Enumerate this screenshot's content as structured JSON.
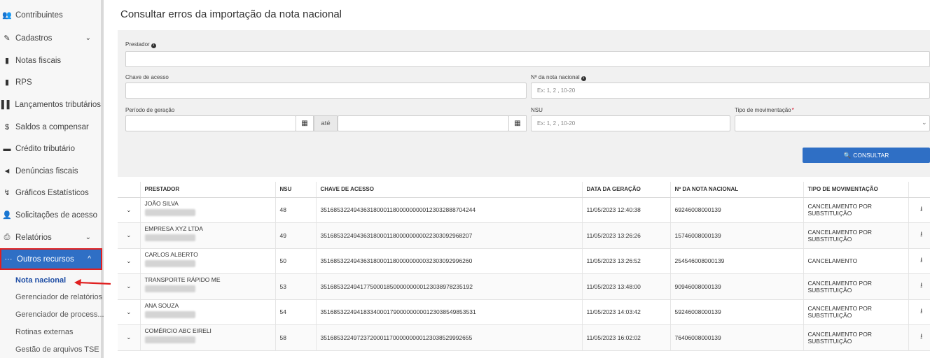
{
  "sidebar": {
    "items": [
      {
        "icon": "users-icon",
        "glyph": "👥",
        "label": "Contribuintes",
        "chevron": ""
      },
      {
        "icon": "edit-icon",
        "glyph": "✎",
        "label": "Cadastros",
        "chevron": "⌄"
      },
      {
        "icon": "file-icon",
        "glyph": "▮",
        "label": "Notas fiscais",
        "chevron": ""
      },
      {
        "icon": "file-icon",
        "glyph": "▮",
        "label": "RPS",
        "chevron": ""
      },
      {
        "icon": "barcode-icon",
        "glyph": "▌▌",
        "label": "Lançamentos tributários",
        "chevron": ""
      },
      {
        "icon": "dollar-icon",
        "glyph": "$",
        "label": "Saldos a compensar",
        "chevron": ""
      },
      {
        "icon": "card-icon",
        "glyph": "▬",
        "label": "Crédito tributário",
        "chevron": ""
      },
      {
        "icon": "megaphone-icon",
        "glyph": "◄",
        "label": "Denúncias fiscais",
        "chevron": ""
      },
      {
        "icon": "chart-icon",
        "glyph": "↯",
        "label": "Gráficos Estatísticos",
        "chevron": ""
      },
      {
        "icon": "user-plus-icon",
        "glyph": "👤",
        "label": "Solicitações de acesso",
        "chevron": ""
      },
      {
        "icon": "print-icon",
        "glyph": "⎙",
        "label": "Relatórios",
        "chevron": "⌄"
      },
      {
        "icon": "dots-icon",
        "glyph": "···",
        "label": "Outros recursos",
        "chevron": "^"
      }
    ],
    "subitems": [
      "Nota nacional",
      "Gerenciador de relatórios",
      "Gerenciador de process...",
      "Rotinas externas",
      "Gestão de arquivos TSE"
    ]
  },
  "page": {
    "title": "Consultar erros da importação da nota nacional"
  },
  "filters": {
    "prestador_label": "Prestador",
    "chave_label": "Chave de acesso",
    "nota_label": "Nº da nota nacional",
    "nota_placeholder": "Ex: 1, 2 , 10-20",
    "periodo_label": "Período de geração",
    "ate": "até",
    "nsu_label": "NSU",
    "nsu_placeholder": "Ex: 1, 2 , 10-20",
    "tipo_label": "Tipo de movimentação",
    "required_mark": "*",
    "consultar_label": "CONSULTAR"
  },
  "table": {
    "headers": [
      "PRESTADOR",
      "NSU",
      "CHAVE DE ACESSO",
      "DATA DA GERAÇÃO",
      "Nº DA NOTA NACIONAL",
      "TIPO DE MOVIMENTAÇÃO"
    ],
    "rows": [
      {
        "prestador": "JOÃO SILVA",
        "nsu": "48",
        "chave": "35168532249436318000118000000000123032888704244",
        "data": "11/05/2023 12:40:38",
        "nota": "69246008000139",
        "tipo": "CANCELAMENTO POR SUBSTITUIÇÃO"
      },
      {
        "prestador": "EMPRESA XYZ LTDA",
        "nsu": "49",
        "chave": "35168532249436318000118000000000223030929682​07",
        "data": "11/05/2023 13:26:26",
        "nota": "15746008000139",
        "tipo": "CANCELAMENTO POR SUBSTITUIÇÃO"
      },
      {
        "prestador": "CARLOS ALBERTO",
        "nsu": "50",
        "chave": "35168532249436318000118000000000323030929962​60",
        "data": "11/05/2023 13:26:52",
        "nota": "254546008000139",
        "tipo": "CANCELAMENTO"
      },
      {
        "prestador": "TRANSPORTE RÁPIDO ME",
        "nsu": "53",
        "chave": "35168532249417750001850000000001230389782351​92",
        "data": "11/05/2023 13:48:00",
        "nota": "90946008000139",
        "tipo": "CANCELAMENTO POR SUBSTITUIÇÃO"
      },
      {
        "prestador": "ANA SOUZA",
        "nsu": "54",
        "chave": "35168532249418334000179000000000123038549853531",
        "data": "11/05/2023 14:03:42",
        "nota": "59246008000139",
        "tipo": "CANCELAMENTO POR SUBSTITUIÇÃO"
      },
      {
        "prestador": "COMÉRCIO ABC EIRELI",
        "nsu": "58",
        "chave": "35168532249723720001170000000001230385299926​55",
        "data": "11/05/2023 16:02:02",
        "nota": "76406008000139",
        "tipo": "CANCELAMENTO POR SUBSTITUIÇÃO"
      }
    ]
  },
  "colors": {
    "accent": "#2f6fc5",
    "highlight": "#e02020"
  }
}
